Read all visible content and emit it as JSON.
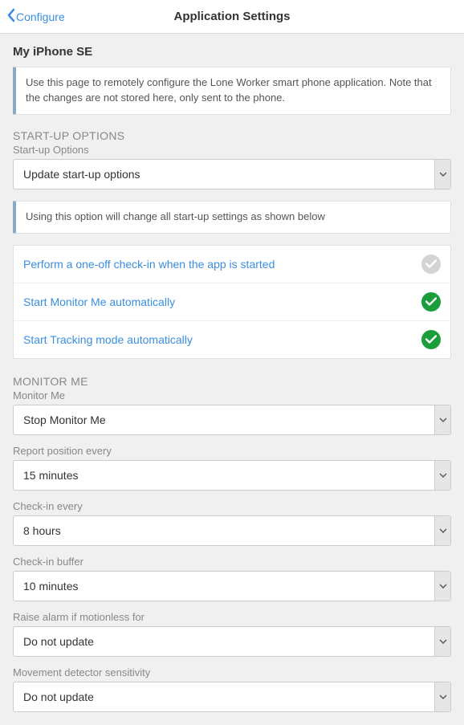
{
  "topbar": {
    "back_label": "Configure",
    "title": "Application Settings"
  },
  "device_name": "My iPhone SE",
  "intro_text": "Use this page to remotely configure the Lone Worker smart phone application. Note that the changes are not stored here, only sent to the phone.",
  "startup": {
    "heading": "START-UP OPTIONS",
    "label": "Start-up Options",
    "selected": "Update start-up options",
    "note": "Using this option will change all start-up settings as shown below",
    "items": [
      {
        "label": "Perform a one-off check-in when the app is started",
        "enabled": false
      },
      {
        "label": "Start Monitor Me automatically",
        "enabled": true
      },
      {
        "label": "Start Tracking mode automatically",
        "enabled": true
      }
    ]
  },
  "monitor_me": {
    "heading": "MONITOR ME",
    "fields": [
      {
        "label": "Monitor Me",
        "value": "Stop Monitor Me"
      },
      {
        "label": "Report position every",
        "value": "15 minutes"
      },
      {
        "label": "Check-in every",
        "value": "8 hours"
      },
      {
        "label": "Check-in buffer",
        "value": "10 minutes"
      },
      {
        "label": "Raise alarm if motionless for",
        "value": "Do not update"
      },
      {
        "label": "Movement detector sensitivity",
        "value": "Do not update"
      }
    ]
  }
}
